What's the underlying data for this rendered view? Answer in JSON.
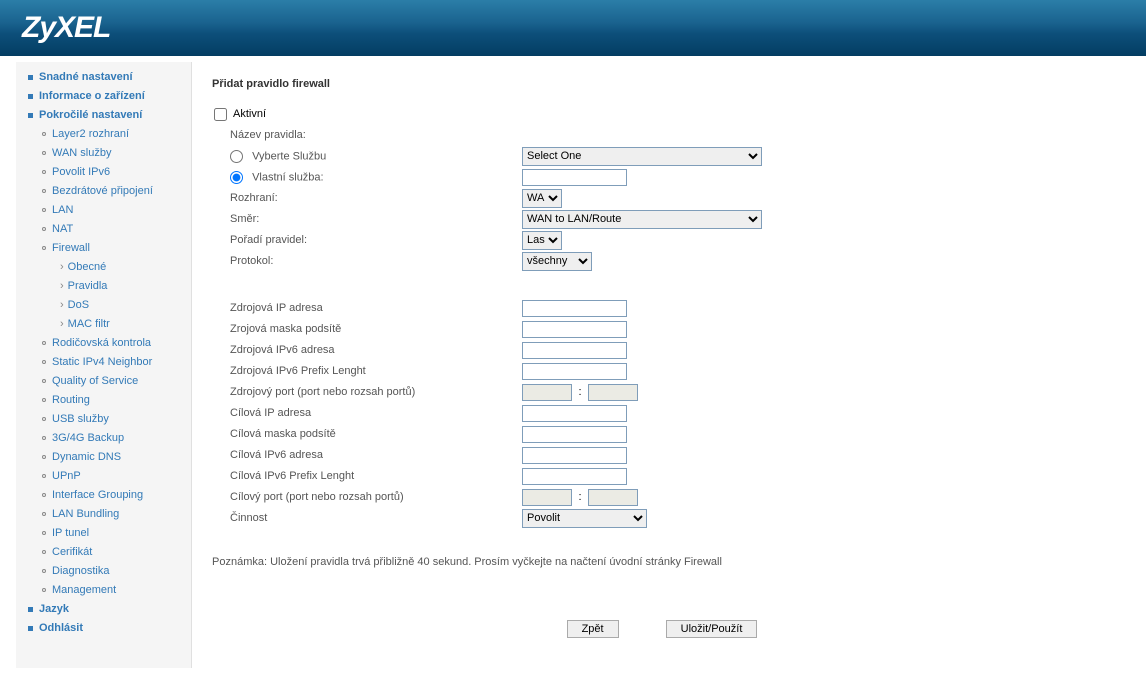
{
  "logo": "ZyXEL",
  "nav": {
    "easy": "Snadné nastavení",
    "deviceinfo": "Informace o zařízení",
    "advanced": "Pokročilé nastavení",
    "layer2": "Layer2 rozhraní",
    "wan": "WAN služby",
    "ipv6": "Povolit IPv6",
    "wireless": "Bezdrátové připojení",
    "lan": "LAN",
    "nat": "NAT",
    "firewall": "Firewall",
    "fw_general": "Obecné",
    "fw_rules": "Pravidla",
    "fw_dos": "DoS",
    "fw_mac": "MAC filtr",
    "parental": "Rodičovská kontrola",
    "staticipv4": "Static IPv4 Neighbor",
    "qos": "Quality of Service",
    "routing": "Routing",
    "usb": "USB služby",
    "backup3g": "3G/4G Backup",
    "dyndns": "Dynamic DNS",
    "upnp": "UPnP",
    "ifgroup": "Interface Grouping",
    "lanbundle": "LAN Bundling",
    "iptunnel": "IP tunel",
    "cert": "Cerifikát",
    "diag": "Diagnostika",
    "mgmt": "Management",
    "lang": "Jazyk",
    "logout": "Odhlásit"
  },
  "form": {
    "title": "Přidat pravidlo firewall",
    "active": "Aktivní",
    "rule_name": "Název pravidla:",
    "select_service": "Vyberte Službu",
    "custom_service": "Vlastní služba:",
    "select_one": "Select One",
    "interface": "Rozhraní:",
    "interface_val": "WAN",
    "direction": "Směr:",
    "direction_val": "WAN to LAN/Route",
    "rule_order": "Pořadí pravidel:",
    "rule_order_val": "Last",
    "protocol": "Protokol:",
    "protocol_val": "všechny",
    "src_ip": "Zdrojová IP adresa",
    "src_mask": "Zrojová maska podsítě",
    "src_ipv6": "Zdrojová IPv6 adresa",
    "src_prefix": "Zdrojová IPv6 Prefix Lenght",
    "src_port": "Zdrojový port (port nebo rozsah portů)",
    "dst_ip": "Cílová IP adresa",
    "dst_mask": "Cílová maska podsítě",
    "dst_ipv6": "Cílová IPv6 adresa",
    "dst_prefix": "Cílová IPv6 Prefix Lenght",
    "dst_port": "Cílový port (port nebo rozsah portů)",
    "action": "Činnost",
    "action_val": "Povolit",
    "note": "Poznámka: Uložení pravidla trvá přibližně 40 sekund. Prosím vyčkejte na načtení úvodní stránky Firewall",
    "btn_back": "Zpět",
    "btn_save": "Uložit/Použít",
    "port_sep": ":"
  }
}
